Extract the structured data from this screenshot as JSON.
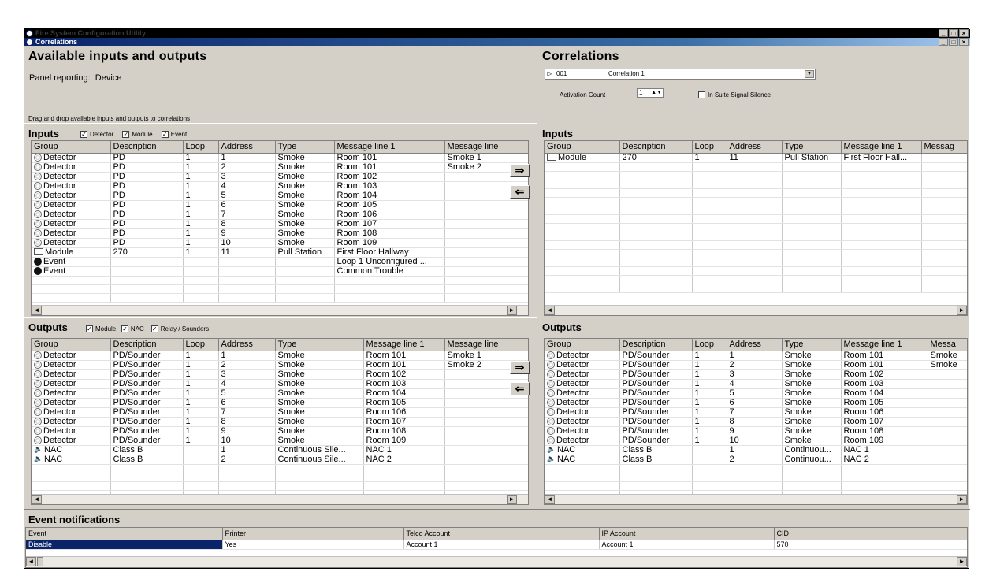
{
  "window": {
    "title_back": "Fire System Configuration Utility",
    "title": "Correlations",
    "controls": [
      "_",
      "□",
      "×"
    ]
  },
  "left": {
    "heading": "Available inputs and outputs",
    "panel_reporting_label": "Panel reporting:",
    "panel_reporting_value": "Device",
    "hint": "Drag and drop available inputs and outputs to correlations",
    "inputs_title": "Inputs",
    "inputs_filters": [
      "Detector",
      "Module",
      "Event"
    ],
    "outputs_title": "Outputs",
    "outputs_filters": [
      "Module",
      "NAC",
      "Relay / Sounders"
    ],
    "inputs_columns": [
      "Group",
      "Description",
      "Loop",
      "Address",
      "Type",
      "Message line 1",
      "Message line"
    ],
    "outputs_columns": [
      "Group",
      "Description",
      "Loop",
      "Address",
      "Type",
      "Message line 1",
      "Message line"
    ],
    "inputs_rows": [
      [
        "Detector",
        "PD",
        "1",
        "1",
        "Smoke",
        "Room 101",
        "Smoke 1"
      ],
      [
        "Detector",
        "PD",
        "1",
        "2",
        "Smoke",
        "Room 101",
        "Smoke 2"
      ],
      [
        "Detector",
        "PD",
        "1",
        "3",
        "Smoke",
        "Room 102",
        ""
      ],
      [
        "Detector",
        "PD",
        "1",
        "4",
        "Smoke",
        "Room 103",
        ""
      ],
      [
        "Detector",
        "PD",
        "1",
        "5",
        "Smoke",
        "Room 104",
        ""
      ],
      [
        "Detector",
        "PD",
        "1",
        "6",
        "Smoke",
        "Room 105",
        ""
      ],
      [
        "Detector",
        "PD",
        "1",
        "7",
        "Smoke",
        "Room 106",
        ""
      ],
      [
        "Detector",
        "PD",
        "1",
        "8",
        "Smoke",
        "Room 107",
        ""
      ],
      [
        "Detector",
        "PD",
        "1",
        "9",
        "Smoke",
        "Room 108",
        ""
      ],
      [
        "Detector",
        "PD",
        "1",
        "10",
        "Smoke",
        "Room 109",
        ""
      ],
      [
        "Module",
        "270",
        "1",
        "11",
        "Pull Station",
        "First Floor Hallway",
        ""
      ],
      [
        "Event",
        "",
        "",
        "",
        "",
        "Loop 1 Unconfigured ...",
        ""
      ],
      [
        "Event",
        "",
        "",
        "",
        "",
        "Common Trouble",
        ""
      ]
    ],
    "outputs_rows": [
      [
        "Detector",
        "PD/Sounder",
        "1",
        "1",
        "Smoke",
        "Room 101",
        "Smoke 1"
      ],
      [
        "Detector",
        "PD/Sounder",
        "1",
        "2",
        "Smoke",
        "Room 101",
        "Smoke 2"
      ],
      [
        "Detector",
        "PD/Sounder",
        "1",
        "3",
        "Smoke",
        "Room 102",
        ""
      ],
      [
        "Detector",
        "PD/Sounder",
        "1",
        "4",
        "Smoke",
        "Room 103",
        ""
      ],
      [
        "Detector",
        "PD/Sounder",
        "1",
        "5",
        "Smoke",
        "Room 104",
        ""
      ],
      [
        "Detector",
        "PD/Sounder",
        "1",
        "6",
        "Smoke",
        "Room 105",
        ""
      ],
      [
        "Detector",
        "PD/Sounder",
        "1",
        "7",
        "Smoke",
        "Room 106",
        ""
      ],
      [
        "Detector",
        "PD/Sounder",
        "1",
        "8",
        "Smoke",
        "Room 107",
        ""
      ],
      [
        "Detector",
        "PD/Sounder",
        "1",
        "9",
        "Smoke",
        "Room 108",
        ""
      ],
      [
        "Detector",
        "PD/Sounder",
        "1",
        "10",
        "Smoke",
        "Room 109",
        ""
      ],
      [
        "NAC",
        "Class B",
        "",
        "1",
        "Continuous Sile...",
        "NAC 1",
        ""
      ],
      [
        "NAC",
        "Class B",
        "",
        "2",
        "Continuous Sile...",
        "NAC 2",
        ""
      ]
    ]
  },
  "right": {
    "heading": "Correlations",
    "correlation_number": "001",
    "correlation_name": "Correlation 1",
    "activation_label": "Activation Count",
    "activation_value": "1",
    "silence_label": "In Suite Signal Silence",
    "inputs_title": "Inputs",
    "outputs_title": "Outputs",
    "inputs_columns": [
      "Group",
      "Description",
      "Loop",
      "Address",
      "Type",
      "Message line 1",
      "Messag"
    ],
    "outputs_columns": [
      "Group",
      "Description",
      "Loop",
      "Address",
      "Type",
      "Message line 1",
      "Messa"
    ],
    "inputs_rows": [
      [
        "Module",
        "270",
        "1",
        "11",
        "Pull Station",
        "First Floor Hall...",
        ""
      ]
    ],
    "outputs_rows": [
      [
        "Detector",
        "PD/Sounder",
        "1",
        "1",
        "Smoke",
        "Room 101",
        "Smoke"
      ],
      [
        "Detector",
        "PD/Sounder",
        "1",
        "2",
        "Smoke",
        "Room 101",
        "Smoke"
      ],
      [
        "Detector",
        "PD/Sounder",
        "1",
        "3",
        "Smoke",
        "Room 102",
        ""
      ],
      [
        "Detector",
        "PD/Sounder",
        "1",
        "4",
        "Smoke",
        "Room 103",
        ""
      ],
      [
        "Detector",
        "PD/Sounder",
        "1",
        "5",
        "Smoke",
        "Room 104",
        ""
      ],
      [
        "Detector",
        "PD/Sounder",
        "1",
        "6",
        "Smoke",
        "Room 105",
        ""
      ],
      [
        "Detector",
        "PD/Sounder",
        "1",
        "7",
        "Smoke",
        "Room 106",
        ""
      ],
      [
        "Detector",
        "PD/Sounder",
        "1",
        "8",
        "Smoke",
        "Room 107",
        ""
      ],
      [
        "Detector",
        "PD/Sounder",
        "1",
        "9",
        "Smoke",
        "Room 108",
        ""
      ],
      [
        "Detector",
        "PD/Sounder",
        "1",
        "10",
        "Smoke",
        "Room 109",
        ""
      ],
      [
        "NAC",
        "Class B",
        "",
        "1",
        "Continuou...",
        "NAC 1",
        ""
      ],
      [
        "NAC",
        "Class B",
        "",
        "2",
        "Continuou...",
        "NAC 2",
        ""
      ]
    ]
  },
  "events": {
    "heading": "Event notifications",
    "columns": [
      "Event",
      "Printer",
      "Telco Account",
      "IP Account",
      "CID"
    ],
    "row": [
      "Disable",
      "Yes",
      "Account 1",
      "Account 1",
      "570"
    ]
  },
  "icons": {
    "add": "arrow-right-icon",
    "remove": "arrow-left-icon"
  }
}
